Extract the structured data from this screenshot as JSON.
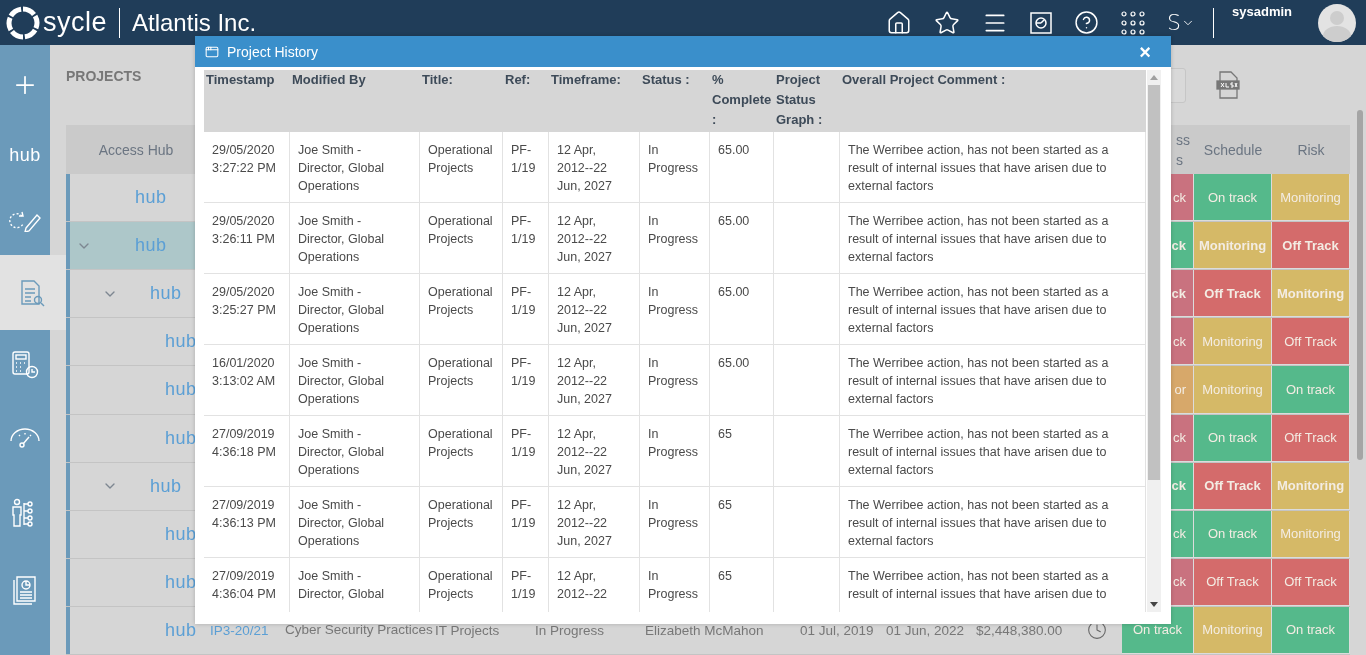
{
  "topbar": {
    "brand": "sycle",
    "company": "Atlantis Inc.",
    "user_initial": "S",
    "username": "sysadmin"
  },
  "sidebar": {
    "items": [
      {
        "selected": false
      },
      {
        "label": "hub",
        "selected": false
      },
      {
        "selected": false
      },
      {
        "selected": true
      },
      {
        "selected": false
      },
      {
        "selected": false
      },
      {
        "selected": false
      },
      {
        "selected": false
      }
    ]
  },
  "page": {
    "title": "PROJECTS"
  },
  "table": {
    "columns": [
      "Access Hub"
    ],
    "progress_header": "ss\ns",
    "schedule_header": "Schedule",
    "risk_header": "Risk",
    "rows": [
      {
        "logo": "hub",
        "selected": false,
        "progress": {
          "text": "ck",
          "color": "#c9727f",
          "bold": false
        },
        "schedule": {
          "text": "On track",
          "color": "#55b98b",
          "bold": false
        },
        "risk": {
          "text": "Monitoring",
          "color": "#d5b967",
          "bold": false
        }
      },
      {
        "logo": "hub",
        "selected": true,
        "expanded": true,
        "progress": {
          "text": "ck",
          "color": "#55b98b",
          "bold": true
        },
        "schedule": {
          "text": "Monitoring",
          "color": "#d5b967",
          "bold": true
        },
        "risk": {
          "text": "Off Track",
          "color": "#d46b6b",
          "bold": true
        },
        "children": [
          {
            "logo": "hub",
            "selected": false,
            "expanded": true,
            "progress": {
              "text": "ck",
              "color": "#c9727f",
              "bold": true
            },
            "schedule": {
              "text": "Off Track",
              "color": "#d46b6b",
              "bold": true
            },
            "risk": {
              "text": "Monitoring",
              "color": "#d5b967",
              "bold": true
            },
            "children": [
              {
                "logo": "hub",
                "selected": false,
                "progress": {
                  "text": "ck",
                  "color": "#c9727f",
                  "bold": false
                },
                "schedule": {
                  "text": "Monitoring",
                  "color": "#d5b967",
                  "bold": false
                },
                "risk": {
                  "text": "Off Track",
                  "color": "#d46b6b",
                  "bold": false
                }
              },
              {
                "logo": "hub",
                "selected": false,
                "progress": {
                  "text": "or",
                  "color": "#d7a86a",
                  "bold": false
                },
                "schedule": {
                  "text": "Monitoring",
                  "color": "#d5b967",
                  "bold": false
                },
                "risk": {
                  "text": "On track",
                  "color": "#55b98b",
                  "bold": false
                }
              },
              {
                "logo": "hub",
                "selected": false,
                "progress": {
                  "text": "ck",
                  "color": "#c9727f",
                  "bold": false
                },
                "schedule": {
                  "text": "On track",
                  "color": "#55b98b",
                  "bold": false
                },
                "risk": {
                  "text": "Off Track",
                  "color": "#d46b6b",
                  "bold": false
                }
              }
            ]
          },
          {
            "logo": "hub",
            "selected": false,
            "expanded": true,
            "progress": {
              "text": "ck",
              "color": "#55b98b",
              "bold": true
            },
            "schedule": {
              "text": "Off Track",
              "color": "#d46b6b",
              "bold": true
            },
            "risk": {
              "text": "Monitoring",
              "color": "#d5b967",
              "bold": true
            },
            "children": [
              {
                "logo": "hub",
                "selected": false,
                "progress": {
                  "text": "ck",
                  "color": "#55b98b",
                  "bold": false
                },
                "schedule": {
                  "text": "On track",
                  "color": "#55b98b",
                  "bold": false
                },
                "risk": {
                  "text": "Monitoring",
                  "color": "#d5b967",
                  "bold": false
                }
              },
              {
                "logo": "hub",
                "selected": false,
                "progress": {
                  "text": "ck",
                  "color": "#c9727f",
                  "bold": false
                },
                "schedule": {
                  "text": "Off Track",
                  "color": "#d46b6b",
                  "bold": false
                },
                "risk": {
                  "text": "Off Track",
                  "color": "#d46b6b",
                  "bold": false
                }
              },
              {
                "logo": "hub",
                "selected": false,
                "ref": "IP3-20/21",
                "name": "Cyber Security Practices",
                "category": "IT Projects",
                "status": "In Progress",
                "manager": "Elizabeth McMahon",
                "start": "01 Jul, 2019",
                "end": "01 Jun, 2022",
                "budget": "$2,448,380.00",
                "progress": {
                  "text": "On track",
                  "color": "#55b98b",
                  "bold": false
                },
                "schedule": {
                  "text": "Monitoring",
                  "color": "#d5b967",
                  "bold": false
                },
                "risk": {
                  "text": "On track",
                  "color": "#55b98b",
                  "bold": false
                }
              }
            ]
          }
        ]
      }
    ]
  },
  "dialog": {
    "title": "Project History",
    "close": "×",
    "columns": [
      "Timestamp",
      "Modified By",
      "Title:",
      "Ref:",
      "Timeframe:",
      "Status :",
      "% Complete :",
      "Project Status Graph :",
      "Overall Project Comment :"
    ],
    "rows": [
      {
        "timestamp": "29/05/2020 3:27:22 PM",
        "modified_by": "Joe Smith - Director, Global Operations",
        "title": "Operational Projects",
        "ref": "PF-1/19",
        "timeframe": "12 Apr, 2012--22 Jun, 2027",
        "status": "In Progress",
        "complete": "65.00",
        "comment": "The Werribee action, has not been started as a result of internal issues that have arisen due to external factors"
      },
      {
        "timestamp": "29/05/2020 3:26:11 PM",
        "modified_by": "Joe Smith - Director, Global Operations",
        "title": "Operational Projects",
        "ref": "PF-1/19",
        "timeframe": "12 Apr, 2012--22 Jun, 2027",
        "status": "In Progress",
        "complete": "65.00",
        "comment": "The Werribee action, has not been started as a result of internal issues that have arisen due to external factors"
      },
      {
        "timestamp": "29/05/2020 3:25:27 PM",
        "modified_by": "Joe Smith - Director, Global Operations",
        "title": "Operational Projects",
        "ref": "PF-1/19",
        "timeframe": "12 Apr, 2012--22 Jun, 2027",
        "status": "In Progress",
        "complete": "65.00",
        "comment": "The Werribee action, has not been started as a result of internal issues that have arisen due to external factors"
      },
      {
        "timestamp": "16/01/2020 3:13:02 AM",
        "modified_by": "Joe Smith - Director, Global Operations",
        "title": "Operational Projects",
        "ref": "PF-1/19",
        "timeframe": "12 Apr, 2012--22 Jun, 2027",
        "status": "In Progress",
        "complete": "65.00",
        "comment": "The Werribee action, has not been started as a result of internal issues that have arisen due to external factors"
      },
      {
        "timestamp": "27/09/2019 4:36:18 PM",
        "modified_by": "Joe Smith - Director, Global Operations",
        "title": "Operational Projects",
        "ref": "PF-1/19",
        "timeframe": "12 Apr, 2012--22 Jun, 2027",
        "status": "In Progress",
        "complete": "65",
        "comment": "The Werribee action, has not been started as a result of internal issues that have arisen due to external factors"
      },
      {
        "timestamp": "27/09/2019 4:36:13 PM",
        "modified_by": "Joe Smith - Director, Global Operations",
        "title": "Operational Projects",
        "ref": "PF-1/19",
        "timeframe": "12 Apr, 2012--22 Jun, 2027",
        "status": "In Progress",
        "complete": "65",
        "comment": "The Werribee action, has not been started as a result of internal issues that have arisen due to external factors"
      },
      {
        "timestamp": "27/09/2019 4:36:04 PM",
        "modified_by": "Joe Smith - Director, Global",
        "title": "Operational Projects",
        "ref": "PF-1/19",
        "timeframe": "12 Apr, 2012--22",
        "status": "In Progress",
        "complete": "65",
        "comment": "The Werribee action, has not been started as a result of internal issues that have arisen due to"
      }
    ]
  }
}
